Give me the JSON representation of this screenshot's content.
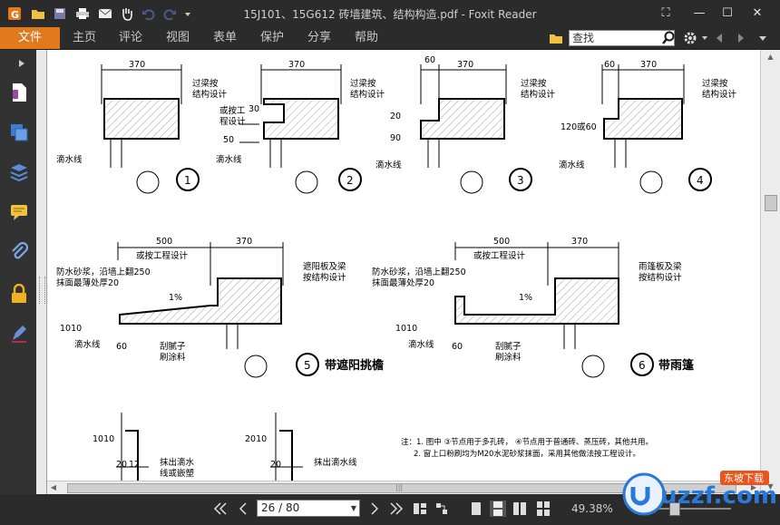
{
  "window": {
    "title": "15J101、15G612 砖墙建筑、结构构造.pdf - Foxit Reader",
    "controls": {
      "restore": "⛶",
      "minimize": "—",
      "maximize": "☐",
      "close": "✕"
    }
  },
  "quick_access": {
    "icons": [
      "app-logo-icon",
      "open-folder-icon",
      "save-icon",
      "print-icon",
      "email-icon",
      "hand-tool-icon",
      "undo-icon",
      "redo-icon",
      "customize-icon"
    ]
  },
  "menu": {
    "file": "文件",
    "items": [
      "主页",
      "评论",
      "视图",
      "表单",
      "保护",
      "分享",
      "帮助"
    ],
    "search_placeholder": "查找"
  },
  "sidebar": {
    "icons": [
      "pages-icon",
      "layers-icon",
      "stack-icon",
      "comments-icon",
      "attachments-icon",
      "lock-icon",
      "pen-icon"
    ]
  },
  "document": {
    "dims": {
      "d370": "370",
      "d60": "60",
      "d500": "500",
      "d30": "30",
      "d50": "50",
      "d20": "20",
      "d90": "90",
      "d120": "120或60",
      "d1010": "1010",
      "d2010": "2010",
      "d12": "12"
    },
    "labels": {
      "beam_design": "过梁按",
      "beam_design2": "结构设计",
      "or_engineering": "或按工",
      "engineering_design": "程设计",
      "drip_line": "滴水线",
      "or_by_engineering": "或按工程设计",
      "waterproof1": "防水砂浆，沿墙上翻250",
      "waterproof2": "抹面最薄处厚20",
      "slope": "1%",
      "putty1": "刮腻子",
      "putty2": "刷涂料",
      "sunshade1": "遮阳板及梁",
      "sunshade2": "按结构设计",
      "canopy1": "雨篷板及梁",
      "canopy2": "按结构设计",
      "detail5": "带遮阳挑檐",
      "detail6": "带雨篷",
      "drip_groove1": "抹出滴水",
      "drip_groove2": "线或嵌塑",
      "drip_groove3": "抹出滴水线",
      "note1": "注：1. 图中 ③节点用于多孔砖， ④节点用于普通砖、蒸压砖，其他共用。",
      "note2": "2. 窗上口粉刷均为M20水泥砂浆抹面，采用其他做法按工程设计。"
    },
    "circles": [
      "1",
      "2",
      "3",
      "4",
      "5",
      "6"
    ]
  },
  "status": {
    "page_value": "26 / 80",
    "zoom": "49.38%"
  },
  "watermark": {
    "text": "uzzf.com",
    "badge": "东坡下载"
  }
}
